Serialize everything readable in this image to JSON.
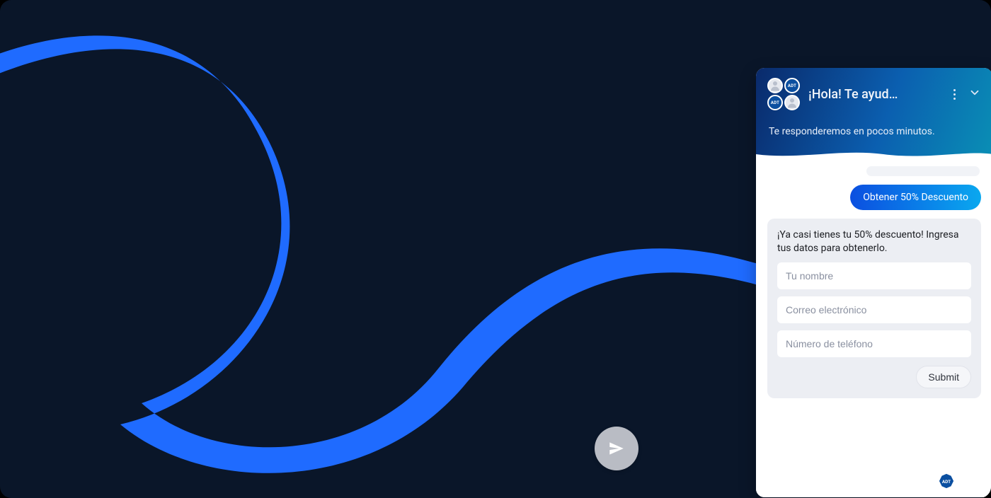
{
  "colors": {
    "stage_bg": "#0a1629",
    "swoosh": "#1f6bff",
    "header_grad_start": "#0a2a6b",
    "header_grad_mid": "#0b5fb0",
    "header_grad_end": "#0a8fb5",
    "pill_grad_start": "#0b4fe0",
    "pill_grad_end": "#0aa8ef",
    "form_bg": "#eceef3",
    "fab_bg": "#b9bcc4"
  },
  "header": {
    "title": "¡Hola! Te ayud…",
    "avatar_badge": "ADT"
  },
  "subheader": "Te responderemos en pocos minutos.",
  "user_pill": "Obtener 50% Descuento",
  "form": {
    "message": "¡Ya casi tienes tu 50% descuento! Ingresa tus datos para obtenerlo.",
    "name_placeholder": "Tu nombre",
    "email_placeholder": "Correo electrónico",
    "phone_placeholder": "Número de teléfono",
    "submit_label": "Submit"
  },
  "brand_badge": "ADT"
}
